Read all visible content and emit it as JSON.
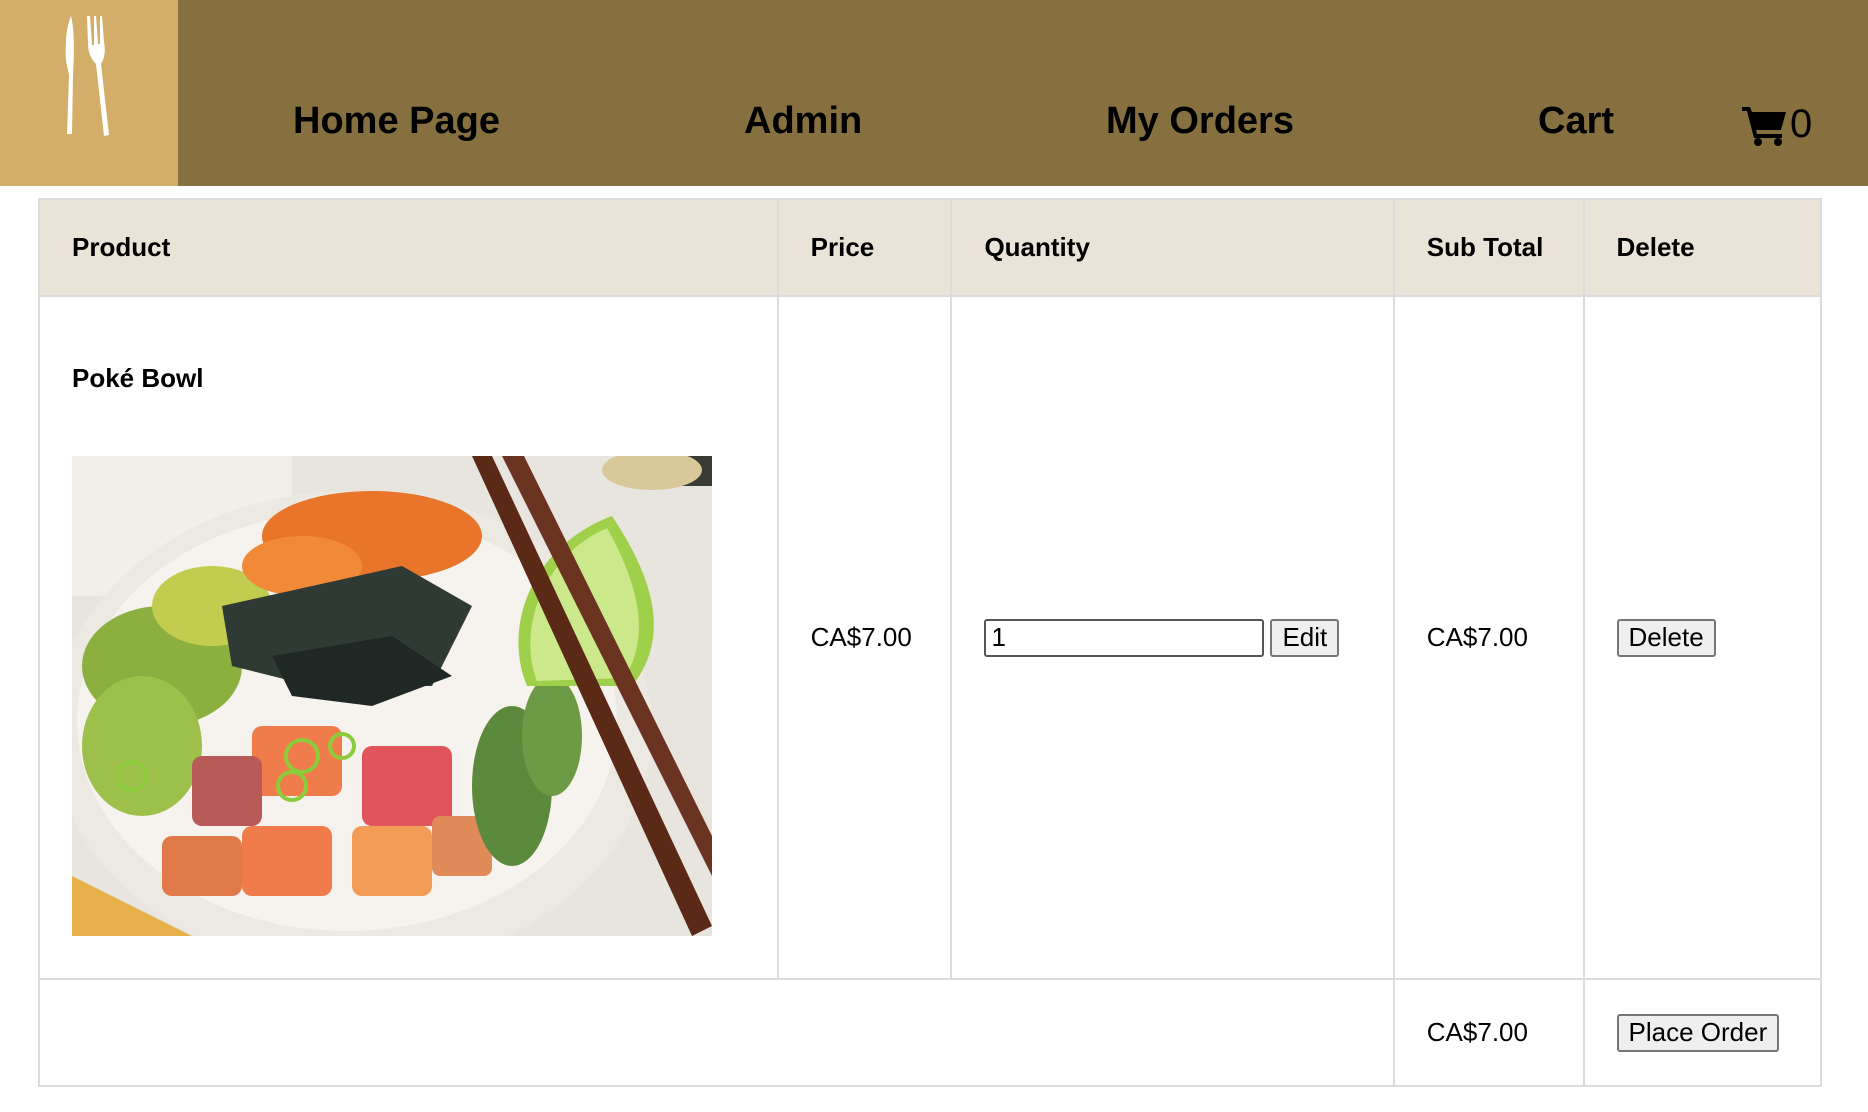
{
  "nav": {
    "home": "Home Page",
    "admin": "Admin",
    "orders": "My Orders",
    "cart": "Cart",
    "cart_count": "0"
  },
  "icons": {
    "logo": "fork-knife-icon",
    "cart": "shopping-cart-icon"
  },
  "colors": {
    "header": "#86703f",
    "logo_box": "#d2ae68",
    "table_header": "#e9e3d8"
  },
  "table": {
    "headers": {
      "product": "Product",
      "price": "Price",
      "quantity": "Quantity",
      "subtotal": "Sub Total",
      "delete": "Delete"
    },
    "items": [
      {
        "name": "Poké Bowl",
        "price": "CA$7.00",
        "quantity": "1",
        "edit_label": "Edit",
        "subtotal": "CA$7.00",
        "delete_label": "Delete"
      }
    ],
    "total": "CA$7.00",
    "place_order_label": "Place Order"
  }
}
